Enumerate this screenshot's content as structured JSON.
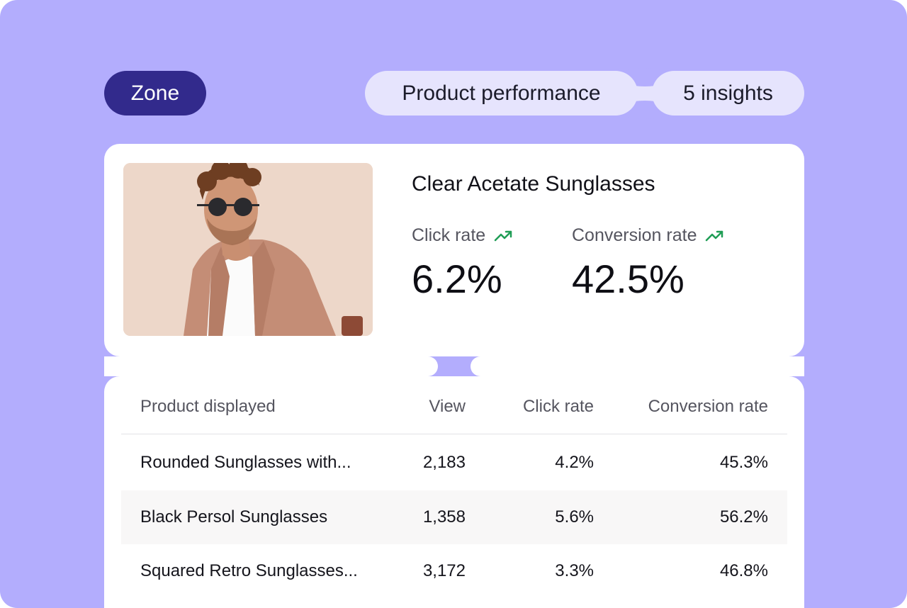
{
  "header": {
    "zone_label": "Zone",
    "section_label": "Product performance",
    "insights_label": "5 insights"
  },
  "product": {
    "title": "Clear Acetate Sunglasses",
    "metrics": [
      {
        "label": "Click rate",
        "value": "6.2%",
        "trend_icon": "trending-up-icon"
      },
      {
        "label": "Conversion rate",
        "value": "42.5%",
        "trend_icon": "trending-up-icon"
      }
    ]
  },
  "table": {
    "columns": [
      "Product displayed",
      "View",
      "Click rate",
      "Conversion rate"
    ],
    "rows": [
      {
        "name": "Rounded Sunglasses with...",
        "view": "2,183",
        "click_rate": "4.2%",
        "conversion_rate": "45.3%"
      },
      {
        "name": "Black Persol Sunglasses",
        "view": "1,358",
        "click_rate": "5.6%",
        "conversion_rate": "56.2%"
      },
      {
        "name": "Squared Retro Sunglasses...",
        "view": "3,172",
        "click_rate": "3.3%",
        "conversion_rate": "46.8%"
      }
    ]
  },
  "colors": {
    "background": "#b3adfd",
    "zone_pill": "#322a8c",
    "chip": "#e6e4fd",
    "trend_green": "#1f9d55"
  }
}
